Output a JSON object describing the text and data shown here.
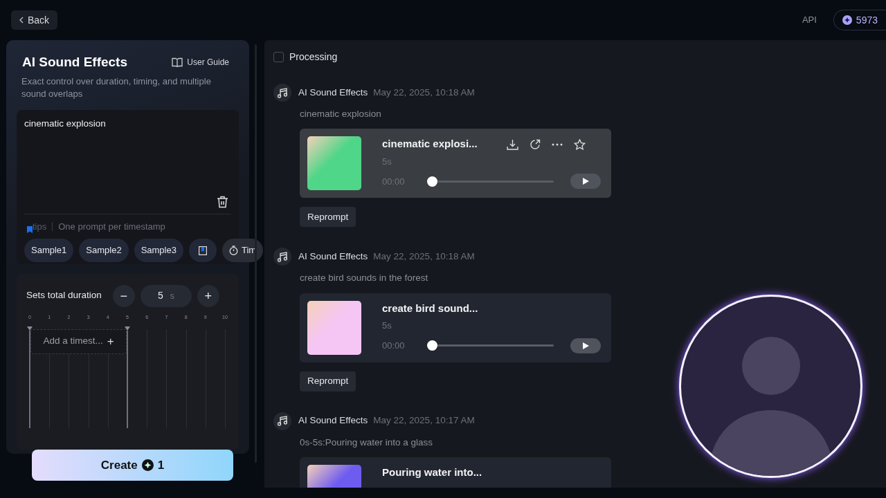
{
  "header": {
    "back": "Back",
    "api": "API",
    "credits": "5973"
  },
  "tool": {
    "title": "AI Sound Effects",
    "guide": "User Guide",
    "subtitle": "Exact control over duration, timing, and multiple sound overlaps",
    "prompt": "cinematic explosion",
    "tips_label": "tips",
    "tips_text": "One prompt per timestamp",
    "chips": [
      {
        "kind": "text",
        "label": "Sample1"
      },
      {
        "kind": "text",
        "label": "Sample2"
      },
      {
        "kind": "text",
        "label": "Sample3"
      },
      {
        "kind": "bookmark"
      },
      {
        "kind": "timer",
        "label": "Tim"
      }
    ],
    "duration_label": "Sets total duration",
    "duration_minus": "−",
    "duration_value": "5",
    "duration_unit": "s",
    "duration_plus": "+",
    "ticks": [
      {
        "label": "0",
        "marker": true
      },
      {
        "label": "1",
        "marker": false
      },
      {
        "label": "2",
        "marker": false
      },
      {
        "label": "3",
        "marker": false
      },
      {
        "label": "4",
        "marker": false
      },
      {
        "label": "5",
        "marker": true
      },
      {
        "label": "6",
        "marker": false
      },
      {
        "label": "7",
        "marker": false
      },
      {
        "label": "8",
        "marker": false
      },
      {
        "label": "9",
        "marker": false
      },
      {
        "label": "10",
        "marker": false
      }
    ],
    "timeline": {
      "add_label": "Add a timest...",
      "add_icon": "+"
    },
    "create": {
      "label": "Create",
      "cost": "1"
    }
  },
  "results": {
    "filter": {
      "label": "Processing",
      "checked": false
    },
    "items": [
      {
        "source": "AI Sound Effects",
        "date": "May 22, 2025, 10:18 AM",
        "prompt": "cinematic explosion",
        "card": {
          "title": "cinematic explosi...",
          "duration": "5s",
          "time": "00:00",
          "level": 0,
          "color": "#4fd688",
          "hovered": true
        },
        "action": "Reprompt"
      },
      {
        "source": "AI Sound Effects",
        "date": "May 22, 2025, 10:18 AM",
        "prompt": "create bird sounds in the forest",
        "card": {
          "title": "create bird sound...",
          "duration": "5s",
          "time": "00:00",
          "level": 0,
          "color": "#f5c6f4",
          "hovered": false
        },
        "action": "Reprompt"
      },
      {
        "source": "AI Sound Effects",
        "date": "May 22, 2025, 10:17 AM",
        "prompt": "0s-5s:Pouring water into a glass",
        "card": {
          "title": "Pouring water into...",
          "color": "#6e5cf0",
          "hovered": false
        }
      }
    ]
  }
}
